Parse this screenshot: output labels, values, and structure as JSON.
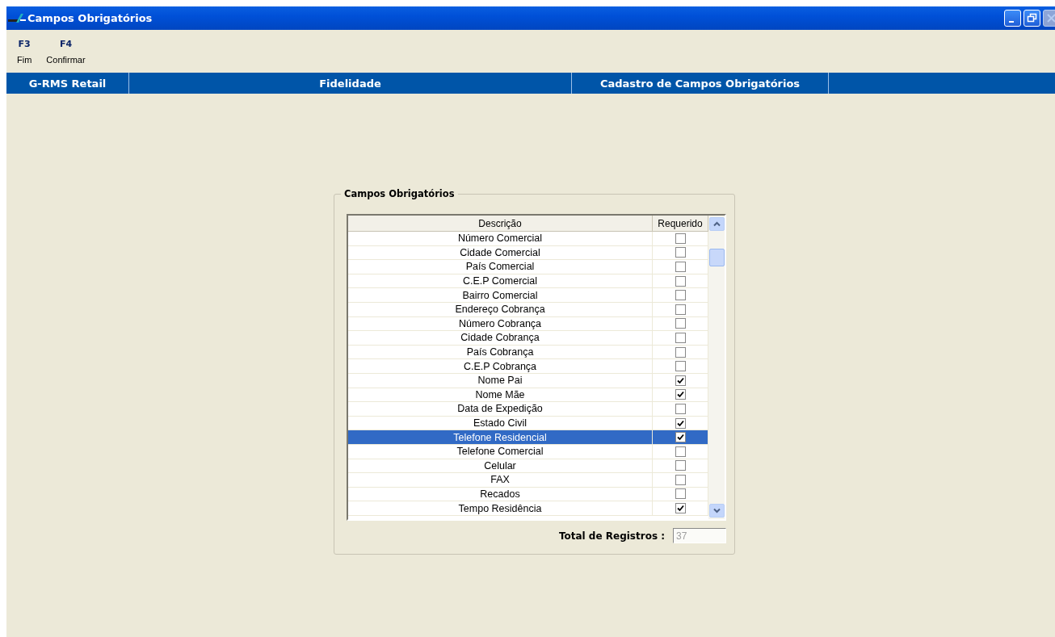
{
  "window": {
    "title": "Campos Obrigatórios"
  },
  "toolbar": [
    {
      "key": "F3",
      "label": "Fim"
    },
    {
      "key": "F4",
      "label": "Confirmar"
    }
  ],
  "breadcrumb": [
    "G-RMS Retail",
    "Fidelidade",
    "Cadastro de Campos Obrigatórios"
  ],
  "group": {
    "title": "Campos Obrigatórios",
    "table": {
      "columns": [
        "Descrição",
        "Requerido"
      ],
      "rows": [
        {
          "description": "Número Comercial",
          "required": false,
          "selected": false
        },
        {
          "description": "Cidade Comercial",
          "required": false,
          "selected": false
        },
        {
          "description": "País Comercial",
          "required": false,
          "selected": false
        },
        {
          "description": "C.E.P Comercial",
          "required": false,
          "selected": false
        },
        {
          "description": "Bairro Comercial",
          "required": false,
          "selected": false
        },
        {
          "description": "Endereço Cobrança",
          "required": false,
          "selected": false
        },
        {
          "description": "Número Cobrança",
          "required": false,
          "selected": false
        },
        {
          "description": "Cidade Cobrança",
          "required": false,
          "selected": false
        },
        {
          "description": "País Cobrança",
          "required": false,
          "selected": false
        },
        {
          "description": "C.E.P Cobrança",
          "required": false,
          "selected": false
        },
        {
          "description": "Nome Pai",
          "required": true,
          "selected": false
        },
        {
          "description": "Nome Mãe",
          "required": true,
          "selected": false
        },
        {
          "description": "Data de Expedição",
          "required": false,
          "selected": false
        },
        {
          "description": "Estado Civil",
          "required": true,
          "selected": false
        },
        {
          "description": "Telefone Residencial",
          "required": true,
          "selected": true
        },
        {
          "description": "Telefone Comercial",
          "required": false,
          "selected": false
        },
        {
          "description": "Celular",
          "required": false,
          "selected": false
        },
        {
          "description": "FAX",
          "required": false,
          "selected": false
        },
        {
          "description": "Recados",
          "required": false,
          "selected": false
        },
        {
          "description": "Tempo Residência",
          "required": true,
          "selected": false
        }
      ]
    },
    "total": {
      "label": "Total de Registros :",
      "value": "37",
      "disabled": true
    }
  }
}
